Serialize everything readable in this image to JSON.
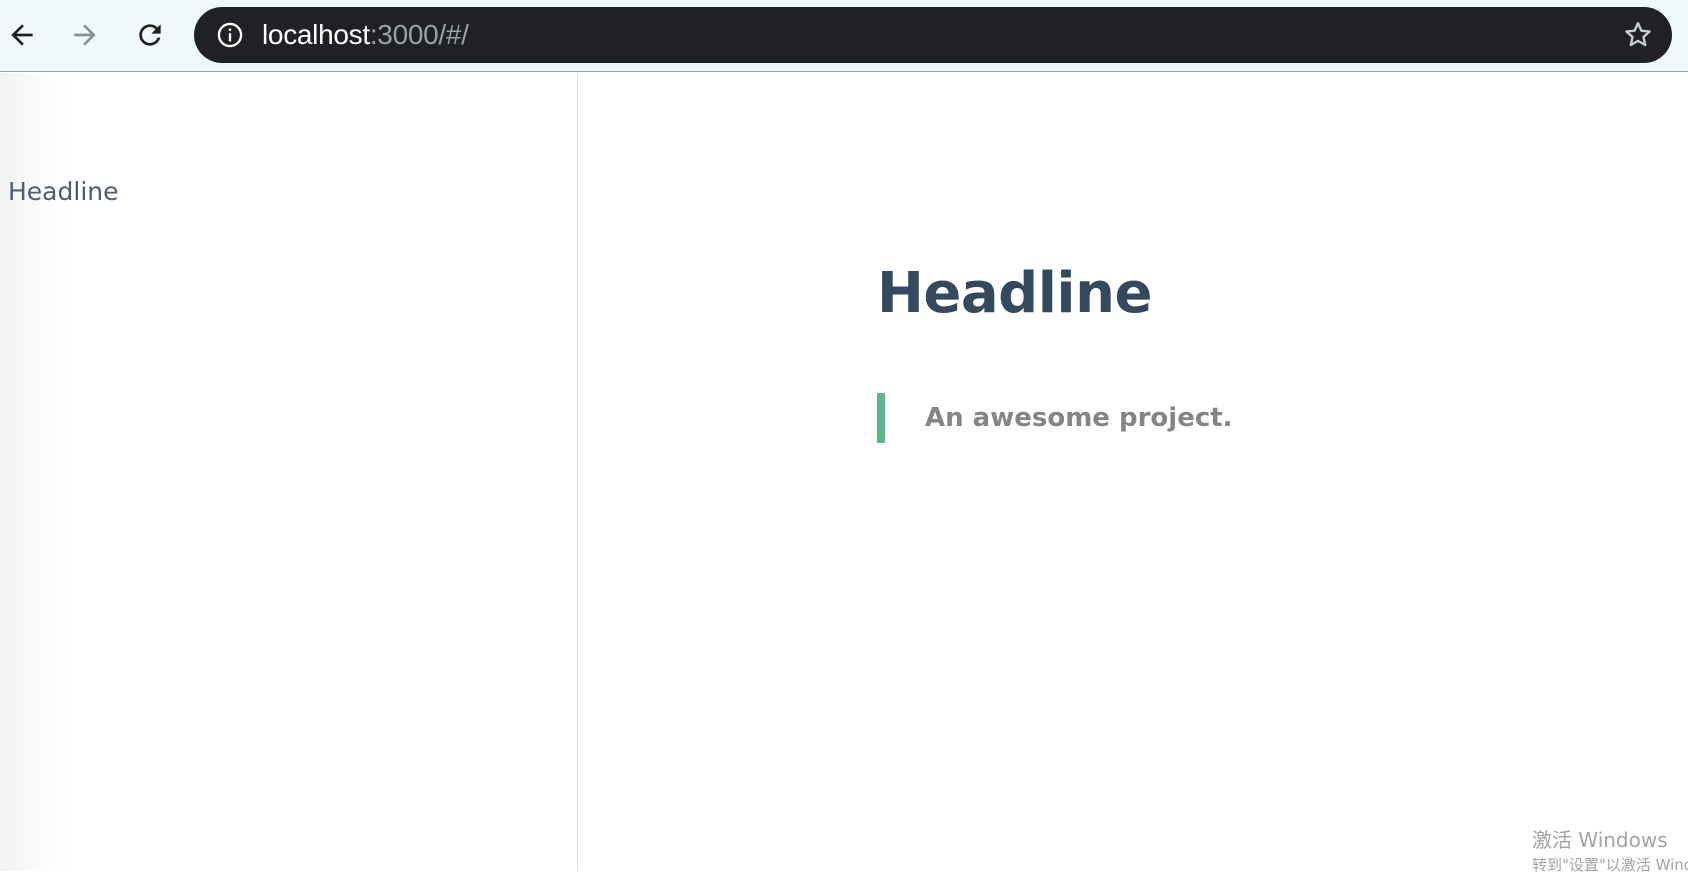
{
  "browser": {
    "url_host": "localhost",
    "url_rest": ":3000/#/",
    "icons": {
      "back": "arrow-left-icon",
      "forward": "arrow-right-icon",
      "reload": "reload-icon",
      "info": "info-icon",
      "bookmark": "star-icon"
    },
    "forward_enabled": false
  },
  "sidebar": {
    "items": [
      {
        "label": "Headline"
      }
    ]
  },
  "main": {
    "headline": "Headline",
    "blockquote": "An awesome project."
  },
  "watermark": {
    "line1": "激活 Windows",
    "line2": "转到\"设置\"以激活 Windows。"
  },
  "colors": {
    "accent": "#5fb88a",
    "heading": "#34495e",
    "sidebar_text": "#505d6b",
    "quote_text": "#858585",
    "address_bar": "#202124"
  }
}
